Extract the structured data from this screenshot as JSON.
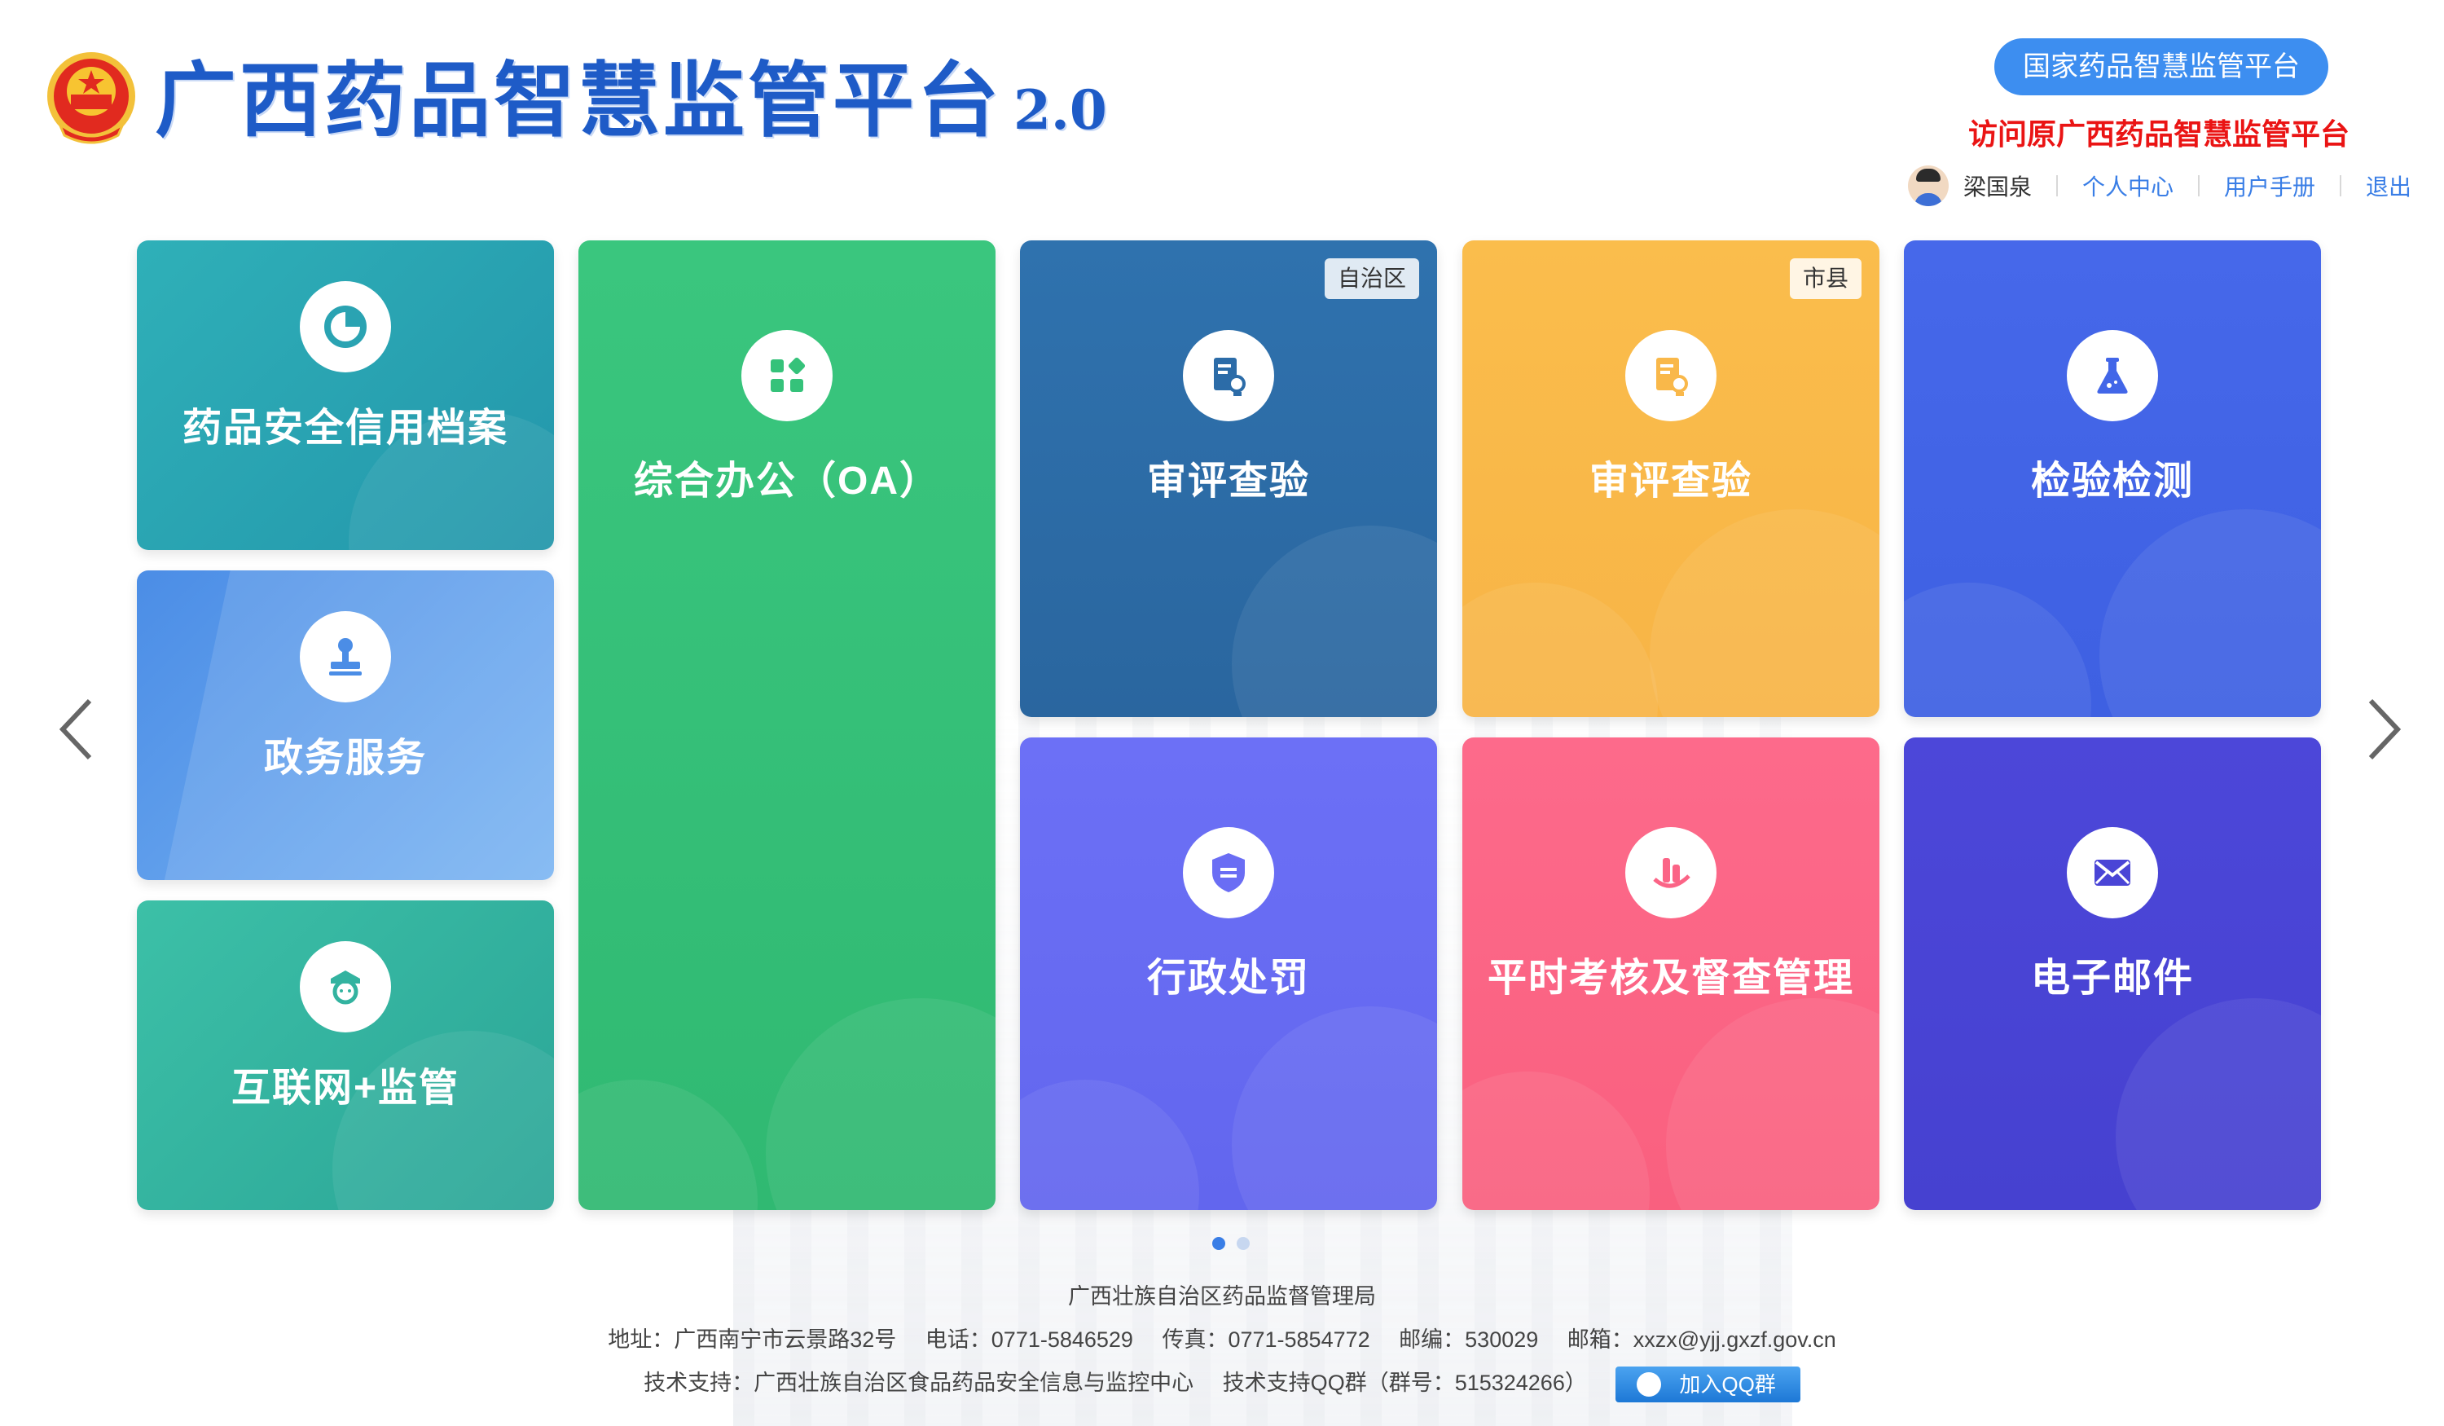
{
  "header": {
    "title": "广西药品智慧监管平台",
    "version": "2.0",
    "national_platform_button": "国家药品智慧监管平台",
    "old_platform_link": "访问原广西药品智慧监管平台"
  },
  "user": {
    "name": "梁国泉",
    "links": [
      "个人中心",
      "用户手册",
      "退出"
    ]
  },
  "tiles": [
    {
      "label": "药品安全信用档案",
      "icon": "pie-chart-icon",
      "color": "#2aa3b2"
    },
    {
      "label": "政务服务",
      "icon": "stamp-icon",
      "color": "#6fa8ef"
    },
    {
      "label": "互联网+监管",
      "icon": "officer-icon",
      "color": "#33b3a0"
    },
    {
      "label": "综合办公（OA）",
      "icon": "apps-icon",
      "color": "#35c27a"
    },
    {
      "label": "审评查验",
      "tag": "自治区",
      "icon": "document-review-icon",
      "color": "#2c6ca8"
    },
    {
      "label": "审评查验",
      "tag": "市县",
      "icon": "document-review-icon",
      "color": "#f9b84a"
    },
    {
      "label": "检验检测",
      "icon": "flask-icon",
      "color": "#4266e8"
    },
    {
      "label": "行政处罚",
      "icon": "penalty-shield-icon",
      "color": "#6a6df4"
    },
    {
      "label": "平时考核及督查管理",
      "icon": "assessment-icon",
      "color": "#fb6486"
    },
    {
      "label": "电子邮件",
      "icon": "mail-icon",
      "color": "#4a45d6"
    }
  ],
  "footer": {
    "org": "广西壮族自治区药品监督管理局",
    "address": "地址：广西南宁市云景路32号",
    "phone": "电话：0771-5846529",
    "fax": "传真：0771-5854772",
    "zip": "邮编：530029",
    "email": "邮箱：xxzx@yjj.gxzf.gov.cn",
    "tech_support": "技术支持：广西壮族自治区食品药品安全信息与监控中心",
    "qq_group": "技术支持QQ群（群号：515324266）",
    "qq_button": "加入QQ群"
  }
}
